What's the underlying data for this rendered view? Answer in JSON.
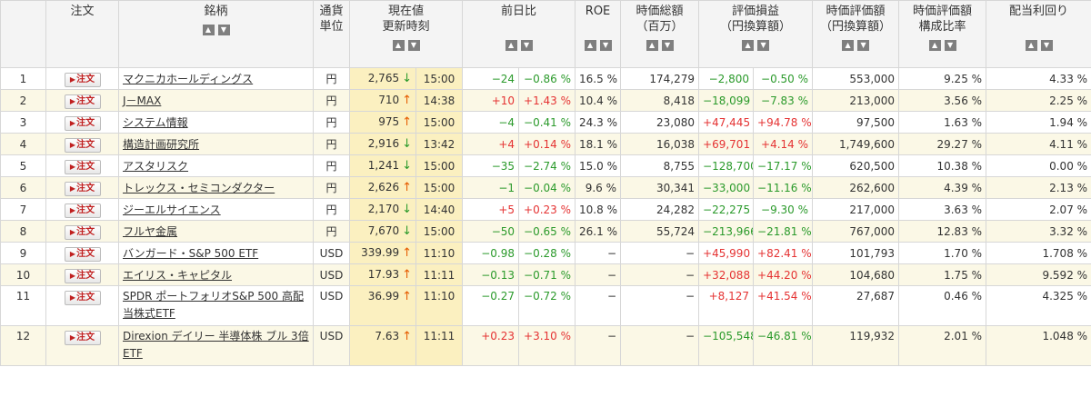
{
  "headers": {
    "order": "注文",
    "name": "銘柄",
    "currency_line1": "通貨",
    "currency_line2": "単位",
    "price_line1": "現在値",
    "price_line2": "更新時刻",
    "change": "前日比",
    "roe": "ROE",
    "mcap_line1": "時価総額",
    "mcap_line2": "（百万）",
    "pl_line1": "評価損益",
    "pl_line2": "（円換算額）",
    "value_line1": "時価評価額",
    "value_line2": "（円換算額）",
    "ratio_line1": "時価評価額",
    "ratio_line2": "構成比率",
    "yield": "配当利回り"
  },
  "sort_icons": {
    "up": "▲",
    "down": "▼"
  },
  "order_button": {
    "label": "注文",
    "icon": "▶"
  },
  "colors": {
    "positive": "#e53333",
    "negative": "#2b9a2b",
    "arrow_up": "#e65c00",
    "arrow_down": "#2b9a2b",
    "row_alt": "#fbf8e6",
    "price_highlight": "#fbf0c0"
  },
  "rows": [
    {
      "num": "1",
      "name": "マクニカホールディングス",
      "currency": "円",
      "price": "2,765",
      "dir": "down",
      "arrow": "↓",
      "time": "15:00",
      "change": "−24",
      "change_pct": "−0.86 %",
      "change_sign": "neg",
      "roe": "16.5 %",
      "mcap": "174,279",
      "pl": "−2,800",
      "pl_pct": "−0.50 %",
      "pl_sign": "neg",
      "value": "553,000",
      "ratio": "9.25 %",
      "yield": "4.33 %"
    },
    {
      "num": "2",
      "name": "J－MAX",
      "currency": "円",
      "price": "710",
      "dir": "up",
      "arrow": "↑",
      "time": "14:38",
      "change": "+10",
      "change_pct": "+1.43 %",
      "change_sign": "pos",
      "roe": "10.4 %",
      "mcap": "8,418",
      "pl": "−18,099",
      "pl_pct": "−7.83 %",
      "pl_sign": "neg",
      "value": "213,000",
      "ratio": "3.56 %",
      "yield": "2.25 %"
    },
    {
      "num": "3",
      "name": "システム情報",
      "currency": "円",
      "price": "975",
      "dir": "up",
      "arrow": "↑",
      "time": "15:00",
      "change": "−4",
      "change_pct": "−0.41 %",
      "change_sign": "neg",
      "roe": "24.3 %",
      "mcap": "23,080",
      "pl": "+47,445",
      "pl_pct": "+94.78 %",
      "pl_sign": "pos",
      "value": "97,500",
      "ratio": "1.63 %",
      "yield": "1.94 %"
    },
    {
      "num": "4",
      "name": "構造計画研究所",
      "currency": "円",
      "price": "2,916",
      "dir": "down",
      "arrow": "↓",
      "time": "13:42",
      "change": "+4",
      "change_pct": "+0.14 %",
      "change_sign": "pos",
      "roe": "18.1 %",
      "mcap": "16,038",
      "pl": "+69,701",
      "pl_pct": "+4.14 %",
      "pl_sign": "pos",
      "value": "1,749,600",
      "ratio": "29.27 %",
      "yield": "4.11 %"
    },
    {
      "num": "5",
      "name": "アスタリスク",
      "currency": "円",
      "price": "1,241",
      "dir": "down",
      "arrow": "↓",
      "time": "15:00",
      "change": "−35",
      "change_pct": "−2.74 %",
      "change_sign": "neg",
      "roe": "15.0 %",
      "mcap": "8,755",
      "pl": "−128,700",
      "pl_pct": "−17.17 %",
      "pl_sign": "neg",
      "value": "620,500",
      "ratio": "10.38 %",
      "yield": "0.00 %"
    },
    {
      "num": "6",
      "name": "トレックス・セミコンダクター",
      "currency": "円",
      "price": "2,626",
      "dir": "up",
      "arrow": "↑",
      "time": "15:00",
      "change": "−1",
      "change_pct": "−0.04 %",
      "change_sign": "neg",
      "roe": "9.6 %",
      "mcap": "30,341",
      "pl": "−33,000",
      "pl_pct": "−11.16 %",
      "pl_sign": "neg",
      "value": "262,600",
      "ratio": "4.39 %",
      "yield": "2.13 %"
    },
    {
      "num": "7",
      "name": "ジーエルサイエンス",
      "currency": "円",
      "price": "2,170",
      "dir": "down",
      "arrow": "↓",
      "time": "14:40",
      "change": "+5",
      "change_pct": "+0.23 %",
      "change_sign": "pos",
      "roe": "10.8 %",
      "mcap": "24,282",
      "pl": "−22,275",
      "pl_pct": "−9.30 %",
      "pl_sign": "neg",
      "value": "217,000",
      "ratio": "3.63 %",
      "yield": "2.07 %"
    },
    {
      "num": "8",
      "name": "フルヤ金属",
      "currency": "円",
      "price": "7,670",
      "dir": "down",
      "arrow": "↓",
      "time": "15:00",
      "change": "−50",
      "change_pct": "−0.65 %",
      "change_sign": "neg",
      "roe": "26.1 %",
      "mcap": "55,724",
      "pl": "−213,966",
      "pl_pct": "−21.81 %",
      "pl_sign": "neg",
      "value": "767,000",
      "ratio": "12.83 %",
      "yield": "3.32 %"
    },
    {
      "num": "9",
      "name": "バンガード・S&P 500 ETF",
      "currency": "USD",
      "price": "339.99",
      "dir": "up",
      "arrow": "↑",
      "time": "11:10",
      "change": "−0.98",
      "change_pct": "−0.28 %",
      "change_sign": "neg",
      "roe": "−",
      "mcap": "−",
      "pl": "+45,990",
      "pl_pct": "+82.41 %",
      "pl_sign": "pos",
      "value": "101,793",
      "ratio": "1.70 %",
      "yield": "1.708 %"
    },
    {
      "num": "10",
      "name": "エイリス・キャピタル",
      "currency": "USD",
      "price": "17.93",
      "dir": "up",
      "arrow": "↑",
      "time": "11:11",
      "change": "−0.13",
      "change_pct": "−0.71 %",
      "change_sign": "neg",
      "roe": "−",
      "mcap": "−",
      "pl": "+32,088",
      "pl_pct": "+44.20 %",
      "pl_sign": "pos",
      "value": "104,680",
      "ratio": "1.75 %",
      "yield": "9.592 %"
    },
    {
      "num": "11",
      "name": "SPDR ポートフォリオS&P 500 高配当株式ETF",
      "currency": "USD",
      "price": "36.99",
      "dir": "up",
      "arrow": "↑",
      "time": "11:10",
      "change": "−0.27",
      "change_pct": "−0.72 %",
      "change_sign": "neg",
      "roe": "−",
      "mcap": "−",
      "pl": "+8,127",
      "pl_pct": "+41.54 %",
      "pl_sign": "pos",
      "value": "27,687",
      "ratio": "0.46 %",
      "yield": "4.325 %"
    },
    {
      "num": "12",
      "name": "Direxion デイリー 半導体株 ブル 3倍 ETF",
      "currency": "USD",
      "price": "7.63",
      "dir": "up",
      "arrow": "↑",
      "time": "11:11",
      "change": "+0.23",
      "change_pct": "+3.10 %",
      "change_sign": "pos",
      "roe": "−",
      "mcap": "−",
      "pl": "−105,548",
      "pl_pct": "−46.81 %",
      "pl_sign": "neg",
      "value": "119,932",
      "ratio": "2.01 %",
      "yield": "1.048 %"
    }
  ]
}
